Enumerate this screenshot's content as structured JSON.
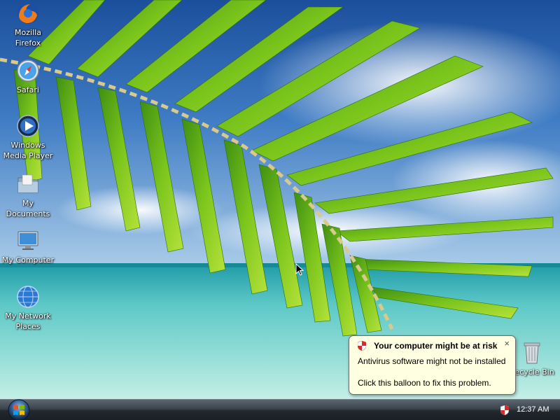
{
  "desktop": {
    "icons": [
      {
        "label_line1": "Mozilla",
        "label_line2": "Firefox",
        "icon": "firefox-icon"
      },
      {
        "label_line1": "Safari",
        "label_line2": "",
        "icon": "safari-icon"
      },
      {
        "label_line1": "Windows",
        "label_line2": "Media Player",
        "icon": "media-player-icon"
      },
      {
        "label_line1": "My",
        "label_line2": "Documents",
        "icon": "folder-icon"
      },
      {
        "label_line1": "My Computer",
        "label_line2": "",
        "icon": "computer-icon"
      },
      {
        "label_line1": "My Network",
        "label_line2": "Places",
        "icon": "network-icon"
      },
      {
        "label_line1": "Recycle Bin",
        "label_line2": "",
        "icon": "recycle-bin-icon"
      }
    ]
  },
  "balloon": {
    "title": "Your computer might be at risk",
    "line1": "Antivirus software might not be installed",
    "line2": "Click this balloon to fix this problem.",
    "close_glyph": "×"
  },
  "taskbar": {
    "clock": "12:37 AM"
  },
  "colors": {
    "balloon_bg": "#ffffe1",
    "shield_red": "#d92b2b"
  }
}
